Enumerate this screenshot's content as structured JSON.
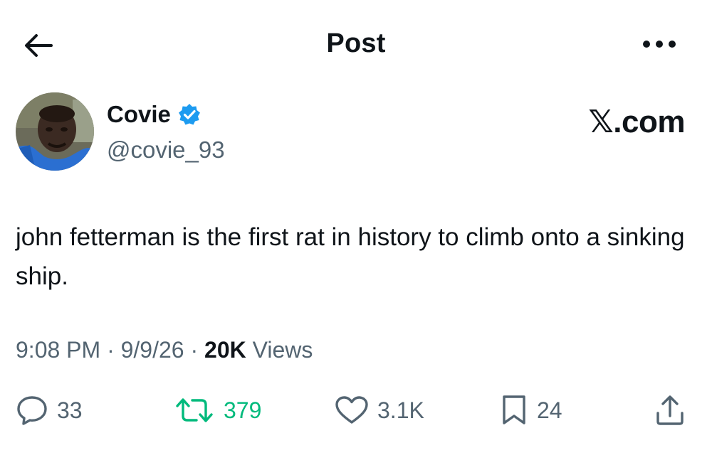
{
  "header": {
    "title": "Post"
  },
  "author": {
    "display_name": "Covie",
    "handle": "@covie_93",
    "verified": true,
    "verified_color": "#1d9bf0"
  },
  "watermark": "𝕏.com",
  "tweet": {
    "text": "john fetterman is the first rat in history to climb onto a sinking ship."
  },
  "meta": {
    "time": "9:08 PM",
    "sep1": " · ",
    "date": "9/9/26",
    "sep2": " · ",
    "views_count": "20K",
    "views_label": " Views"
  },
  "actions": {
    "replies": "33",
    "reposts": "379",
    "likes": "3.1K",
    "bookmarks": "24"
  },
  "colors": {
    "text": "#0f1419",
    "secondary": "#536471",
    "repost_active": "#00ba7c",
    "verified": "#1d9bf0"
  },
  "icons": {
    "back": "arrow-left-icon",
    "more": "more-dots-icon",
    "verified": "verified-badge-icon",
    "reply": "reply-bubble-icon",
    "repost": "repost-icon",
    "like": "heart-icon",
    "bookmark": "bookmark-icon",
    "share": "share-icon"
  }
}
